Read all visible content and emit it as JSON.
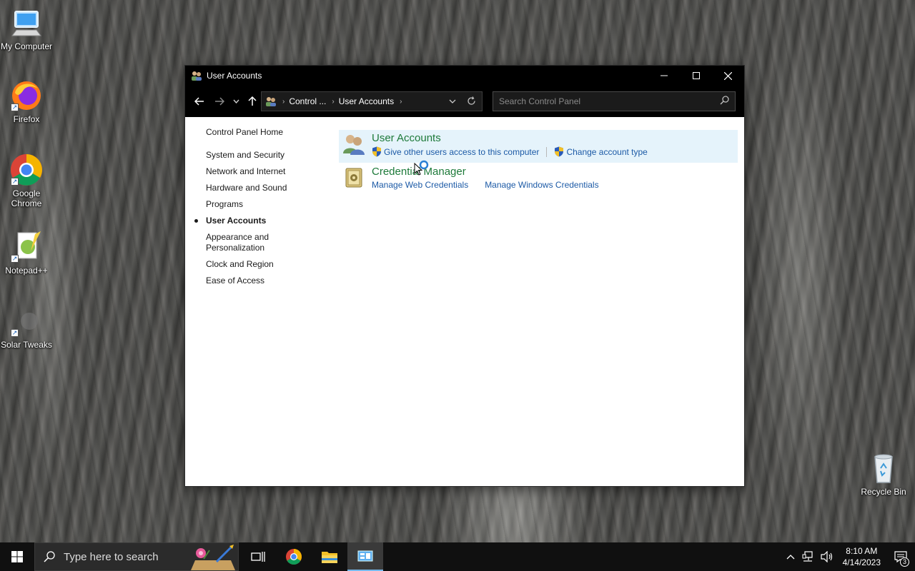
{
  "desktop": {
    "icons": [
      {
        "label": "My Computer",
        "icon": "computer-icon"
      },
      {
        "label": "Firefox",
        "icon": "firefox-icon"
      },
      {
        "label": "Google Chrome",
        "icon": "chrome-icon"
      },
      {
        "label": "Notepad++",
        "icon": "notepad-plus-plus-icon"
      },
      {
        "label": "Solar Tweaks",
        "icon": "solar-tweaks-icon"
      },
      {
        "label": "Recycle Bin",
        "icon": "recycle-bin-icon"
      }
    ]
  },
  "window": {
    "title": "User Accounts",
    "address": {
      "crumbs": [
        "Control ...",
        "User Accounts"
      ]
    },
    "search": {
      "placeholder": "Search Control Panel"
    },
    "sidebar": {
      "home": "Control Panel Home",
      "items": [
        {
          "label": "System and Security",
          "active": false
        },
        {
          "label": "Network and Internet",
          "active": false
        },
        {
          "label": "Hardware and Sound",
          "active": false
        },
        {
          "label": "Programs",
          "active": false
        },
        {
          "label": "User Accounts",
          "active": true
        },
        {
          "label": "Appearance and Personalization",
          "active": false
        },
        {
          "label": "Clock and Region",
          "active": false
        },
        {
          "label": "Ease of Access",
          "active": false
        }
      ]
    },
    "categories": [
      {
        "heading": "User Accounts",
        "links": [
          "Give other users access to this computer",
          "Change account type"
        ]
      },
      {
        "heading": "Credential Manager",
        "links": [
          "Manage Web Credentials",
          "Manage Windows Credentials"
        ]
      }
    ]
  },
  "taskbar": {
    "search_placeholder": "Type here to search",
    "time": "8:10 AM",
    "date": "4/14/2023",
    "notification_count": "3"
  },
  "colors": {
    "link": "#1c5aa6",
    "heading": "#1e7a3a",
    "hover_bg": "#e5f3fb",
    "titlebar": "#000000"
  }
}
